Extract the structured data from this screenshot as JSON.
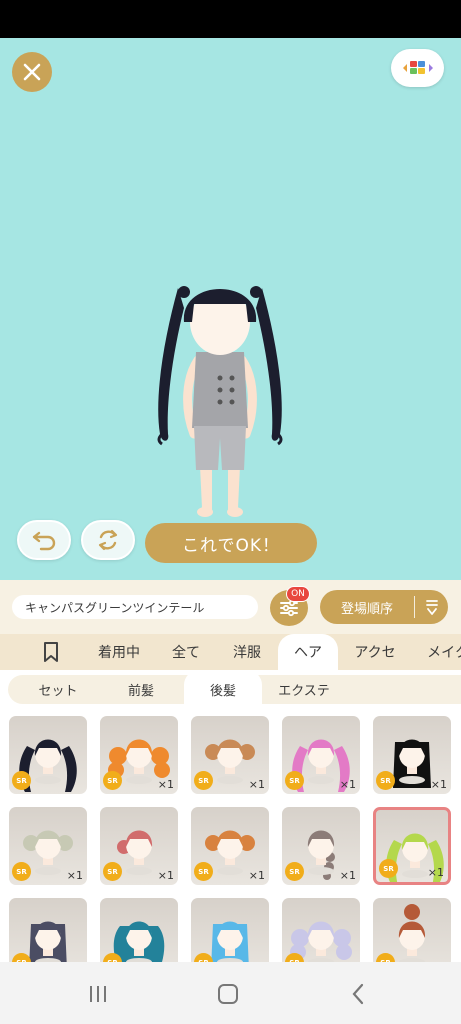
{
  "stage": {
    "ok_button_label": "これでOK！"
  },
  "filter": {
    "item_name": "キャンパスグリーンツインテール",
    "badge": "ON",
    "sort_label": "登場順序"
  },
  "category_tabs": [
    {
      "label": "",
      "icon": "bookmark-icon"
    },
    {
      "label": "着用中"
    },
    {
      "label": "全て"
    },
    {
      "label": "洋服"
    },
    {
      "label": "ヘア",
      "active": true
    },
    {
      "label": "アクセ"
    },
    {
      "label": "メイク"
    }
  ],
  "sub_tabs": [
    {
      "label": "セット"
    },
    {
      "label": "前髪"
    },
    {
      "label": "後髪",
      "active": true
    },
    {
      "label": "エクステ"
    }
  ],
  "items": [
    {
      "rarity": "SR",
      "qty": "",
      "hair": "#1c1e2e",
      "style": "twin-long"
    },
    {
      "rarity": "SR",
      "qty": "×1",
      "hair": "#ef8a2e",
      "style": "twin-curl"
    },
    {
      "rarity": "SR",
      "qty": "×1",
      "hair": "#c98a56",
      "style": "buns"
    },
    {
      "rarity": "SR",
      "qty": "×1",
      "hair": "#e37ac6",
      "style": "twin-long"
    },
    {
      "rarity": "SR",
      "qty": "×1",
      "hair": "#111111",
      "style": "straight"
    },
    {
      "rarity": "SR",
      "qty": "×1",
      "hair": "#c7c9b4",
      "style": "buns"
    },
    {
      "rarity": "SR",
      "qty": "×1",
      "hair": "#d16c6c",
      "style": "side"
    },
    {
      "rarity": "SR",
      "qty": "×1",
      "hair": "#d8823f",
      "style": "buns"
    },
    {
      "rarity": "SR",
      "qty": "×1",
      "hair": "#8c7c78",
      "style": "braid"
    },
    {
      "rarity": "SR",
      "qty": "×1",
      "hair": "#b4d84c",
      "style": "twin-long",
      "selected": true
    },
    {
      "rarity": "SR",
      "qty": "",
      "hair": "#4b4d63",
      "style": "straight"
    },
    {
      "rarity": "SR",
      "qty": "",
      "hair": "#23829a",
      "style": "wavy"
    },
    {
      "rarity": "SR",
      "qty": "",
      "hair": "#58b8e8",
      "style": "straight"
    },
    {
      "rarity": "SR",
      "qty": "",
      "hair": "#c9c7e8",
      "style": "twin-curl"
    },
    {
      "rarity": "SR",
      "qty": "",
      "hair": "#b55a38",
      "style": "bun-top"
    }
  ]
}
